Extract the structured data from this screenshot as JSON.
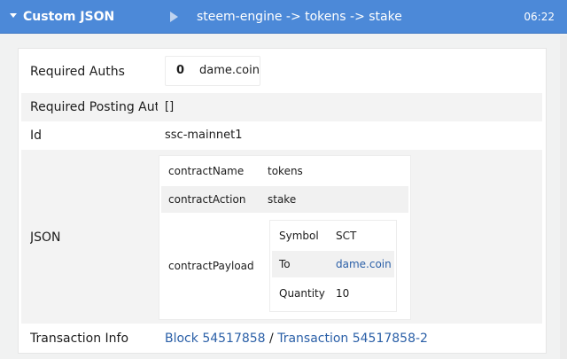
{
  "header": {
    "title": "Custom JSON",
    "operation": "steem-engine -> tokens -> stake",
    "time": "06:22"
  },
  "rows": {
    "required_auths": {
      "label": "Required Auths",
      "index": "0",
      "value": "dame.coin"
    },
    "required_posting_auths": {
      "label": "Required Posting Auths",
      "value": "[]"
    },
    "id": {
      "label": "Id",
      "value": "ssc-mainnet1"
    },
    "json": {
      "label": "JSON",
      "contract_name": {
        "key": "contractName",
        "value": "tokens"
      },
      "contract_action": {
        "key": "contractAction",
        "value": "stake"
      },
      "contract_payload": {
        "key": "contractPayload",
        "symbol": {
          "key": "Symbol",
          "value": "SCT"
        },
        "to": {
          "key": "To",
          "value": "dame.coin"
        },
        "quantity": {
          "key": "Quantity",
          "value": "10"
        }
      }
    },
    "transaction_info": {
      "label": "Transaction Info",
      "block": "Block 54517858",
      "separator": "/",
      "transaction": "Transaction 54517858-2"
    }
  }
}
